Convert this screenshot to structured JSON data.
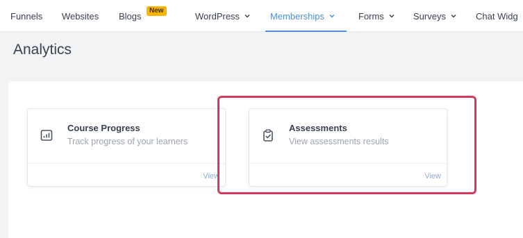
{
  "nav": {
    "items": [
      {
        "label": "Funnels"
      },
      {
        "label": "Websites"
      },
      {
        "label": "Blogs",
        "badge": "New"
      },
      {
        "label": "WordPress"
      },
      {
        "label": "Memberships"
      },
      {
        "label": "Forms"
      },
      {
        "label": "Surveys"
      },
      {
        "label": "Chat Widg"
      }
    ],
    "active_item": "Memberships"
  },
  "page": {
    "title": "Analytics"
  },
  "cards": [
    {
      "title": "Course Progress",
      "description": "Track progress of your learners",
      "action": "View",
      "icon": "chart-icon"
    },
    {
      "title": "Assessments",
      "description": "View assessments results",
      "action": "View",
      "icon": "clipboard-check-icon"
    }
  ],
  "colors": {
    "accent": "#4f8fd6",
    "highlight": "#d2395a",
    "badge": "#f7b500"
  }
}
